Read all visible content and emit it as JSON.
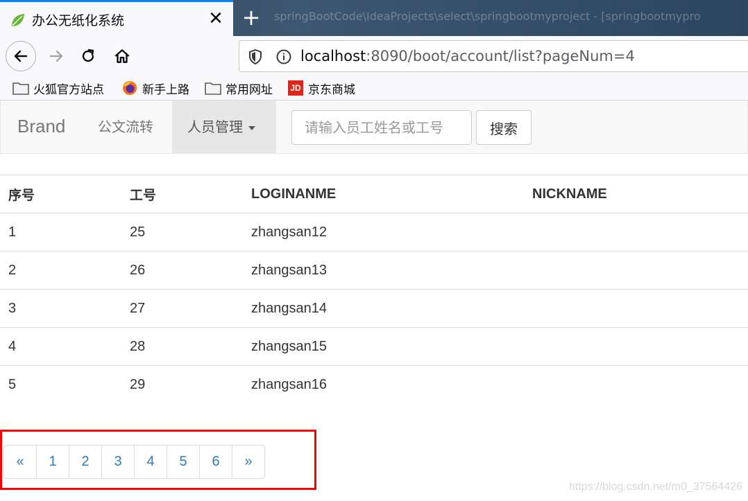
{
  "browser": {
    "tab_title": "办公无纸化系统",
    "tab_close": "✕",
    "new_tab": "+",
    "ghost_tab_text": "springBootCode\\IdeaProjects\\select\\springbootmyproject - [springbootmypro",
    "url_host": "localhost",
    "url_rest": ":8090/boot/account/list?pageNum=4",
    "bookmarks": [
      "火狐官方站点",
      "新手上路",
      "常用网址",
      "京东商城"
    ],
    "jd_badge": "JD"
  },
  "navbar": {
    "brand": "Brand",
    "link_documents": "公文流转",
    "link_people": "人员管理",
    "search_placeholder": "请输入员工姓名或工号",
    "search_button": "搜索"
  },
  "table": {
    "headers": [
      "序号",
      "工号",
      "LOGINANME",
      "NICKNAME"
    ],
    "rows": [
      [
        "1",
        "25",
        "zhangsan12",
        ""
      ],
      [
        "2",
        "26",
        "zhangsan13",
        ""
      ],
      [
        "3",
        "27",
        "zhangsan14",
        ""
      ],
      [
        "4",
        "28",
        "zhangsan15",
        ""
      ],
      [
        "5",
        "29",
        "zhangsan16",
        ""
      ]
    ]
  },
  "pagination": {
    "prev": "«",
    "pages": [
      "1",
      "2",
      "3",
      "4",
      "5",
      "6"
    ],
    "next": "»"
  },
  "watermark": "https://blog.csdn.net/m0_37564426",
  "colors": {
    "link": "#337ab7",
    "highlight_border": "#ff0000",
    "tab_accent": "#0a84ff"
  }
}
